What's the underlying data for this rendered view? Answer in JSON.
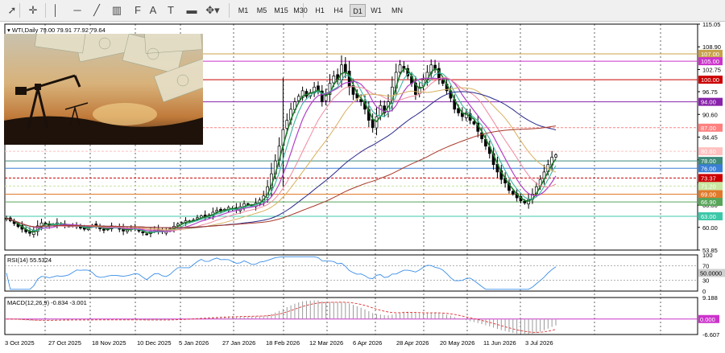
{
  "toolbar": {
    "tools": [
      {
        "name": "cursor-icon",
        "glyph": "➚"
      },
      {
        "name": "crosshair-icon",
        "glyph": "✛"
      },
      {
        "name": "vertical-line-icon",
        "glyph": "│"
      },
      {
        "name": "horizontal-line-icon",
        "glyph": "─"
      },
      {
        "name": "trendline-icon",
        "glyph": "╱"
      },
      {
        "name": "channel-icon",
        "glyph": "▥"
      },
      {
        "name": "fibonacci-icon",
        "glyph": "F"
      },
      {
        "name": "text-tool-icon",
        "glyph": "A"
      },
      {
        "name": "text-label-icon",
        "glyph": "T"
      },
      {
        "name": "rectangle-label-icon",
        "glyph": "▬"
      },
      {
        "name": "shapes-dropdown-icon",
        "glyph": "✥▾"
      }
    ],
    "timeframes": [
      "M1",
      "M5",
      "M15",
      "M30",
      "H1",
      "H4",
      "D1",
      "W1",
      "MN"
    ],
    "active_timeframe": "D1"
  },
  "chart_data": [
    {
      "type": "candlestick",
      "title": "WTI,Daily  79.00 79.91 77.92 79.64",
      "symbol": "WTI",
      "period": "Daily",
      "ohlc": {
        "open": 79.0,
        "high": 79.91,
        "low": 77.92,
        "close": 79.64
      },
      "ylim": [
        53.85,
        115.05
      ],
      "y_ticks": [
        115.05,
        108.9,
        102.75,
        96.75,
        90.6,
        84.45,
        78.3,
        72.15,
        66.0,
        60.0,
        53.85
      ],
      "y_tick_labels": [
        "115.05",
        "108.90",
        "102.75",
        "96.75",
        "90.60",
        "84.45",
        "78.30",
        "72.15",
        "66.00",
        "60.00",
        "53.85"
      ],
      "x_labels": [
        "3 Oct 2025",
        "27 Oct 2025",
        "18 Nov 2025",
        "10 Dec 2025",
        "5 Jan 2026",
        "27 Jan 2026",
        "18 Feb 2026",
        "12 Mar 2026",
        "6 Apr 2026",
        "28 Apr 2026",
        "20 May 2026",
        "11 Jun 2026",
        "3 Jul 2026"
      ],
      "price_levels": [
        {
          "value": 107.0,
          "label": "107.00",
          "color": "#c8a24a"
        },
        {
          "value": 105.0,
          "label": "105.00",
          "color": "#cc33cc"
        },
        {
          "value": 100.0,
          "label": "100.00",
          "color": "#cc0000"
        },
        {
          "value": 94.0,
          "label": "94.00",
          "color": "#8822aa"
        },
        {
          "value": 87.0,
          "label": "87.00",
          "color": "#ff8080"
        },
        {
          "value": 80.6,
          "label": "80.60",
          "color": "#ffc0c0"
        },
        {
          "value": 78.0,
          "label": "78.00",
          "color": "#3d8a7a"
        },
        {
          "value": 76.0,
          "label": "76.00",
          "color": "#3a7fd5"
        },
        {
          "value": 73.37,
          "label": "73.37",
          "color": "#cc0000"
        },
        {
          "value": 71.2,
          "label": "71.20",
          "color": "#c8e6a0"
        },
        {
          "value": 69.0,
          "label": "69.00",
          "color": "#e07a2a"
        },
        {
          "value": 66.9,
          "label": "66.90",
          "color": "#57a55a"
        },
        {
          "value": 63.0,
          "label": "63.00",
          "color": "#3cc8a8"
        }
      ],
      "close_series": [
        62.5,
        61.8,
        61,
        60.2,
        59.5,
        58.8,
        58.4,
        59.1,
        60.4,
        61.2,
        61,
        60.5,
        60.8,
        61.2,
        60.9,
        60.5,
        60.2,
        60.4,
        60.6,
        59.8,
        59.5,
        60.1,
        60.6,
        60.3,
        59.6,
        59.2,
        59.8,
        60.4,
        60.1,
        59.5,
        59,
        59.4,
        59.9,
        59.6,
        59,
        58.5,
        58.1,
        58.9,
        59.3,
        59,
        58.8,
        59.2,
        59.6,
        60.3,
        60.9,
        61.3,
        61.8,
        61.5,
        62,
        62.6,
        63.1,
        62.8,
        63.4,
        64.1,
        64.6,
        64.3,
        64.9,
        65.4,
        65.1,
        64.8,
        65.6,
        66.4,
        66.1,
        65.8,
        66.6,
        67.4,
        68.5,
        71,
        74.5,
        78,
        82,
        86.5,
        89,
        92,
        94,
        95.5,
        97,
        95.5,
        96.5,
        98,
        97,
        94,
        96,
        99,
        101,
        100,
        104,
        102,
        98,
        96,
        95,
        94,
        92,
        89,
        87,
        90,
        93,
        91,
        94,
        98,
        102,
        104,
        103,
        101,
        99,
        96,
        98,
        100,
        102,
        104,
        103,
        100,
        99,
        97,
        95,
        92,
        91,
        90,
        91,
        89,
        88,
        86,
        84,
        82,
        80,
        77,
        75,
        73,
        72,
        70,
        69,
        68,
        67.2,
        66.6,
        67.5,
        69,
        71,
        73,
        75,
        77,
        79,
        79.64
      ],
      "rsi": {
        "label": "RSI(14) 55.5324",
        "value": 55.5324,
        "ylim": [
          0,
          100
        ],
        "y_ticks": [
          100,
          70,
          50,
          30,
          0
        ],
        "y_tick_labels": [
          "100",
          "70",
          "50.0000",
          "30",
          "0"
        ]
      },
      "macd": {
        "label": "MACD(12,26,9) -0.834 -3.001",
        "main": -0.834,
        "signal": -3.001,
        "y_tick_labels": [
          "9.188",
          "0.000",
          "-6.607"
        ],
        "ylim": [
          -6.607,
          9.188
        ]
      }
    }
  ]
}
